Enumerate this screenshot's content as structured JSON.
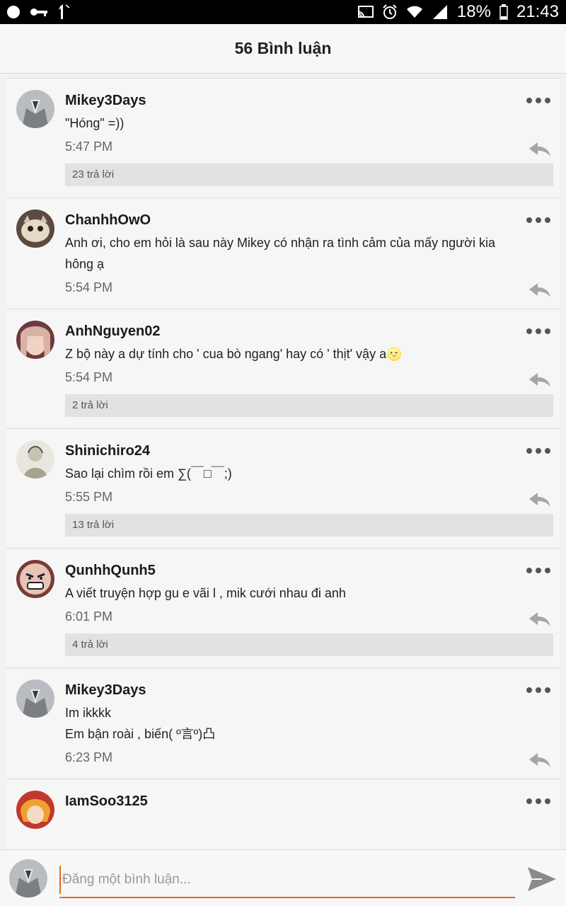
{
  "status_bar": {
    "battery": "18%",
    "time": "21:43",
    "icons": [
      "circle-icon",
      "key-icon",
      "data-arrow-icon",
      "cast-icon",
      "alarm-icon",
      "wifi-icon",
      "signal-icon",
      "battery-icon"
    ]
  },
  "header": {
    "title": "56 Bình luận"
  },
  "comments": [
    {
      "username": "Mikey3Days",
      "lines": [
        "\"Hóng\" =))"
      ],
      "time": "5:47 PM",
      "replies": "23 trả lời",
      "avatar": "avatar-grey-vest"
    },
    {
      "username": "ChanhhOwO",
      "lines": [
        "Anh ơi, cho em hỏi là sau này Mikey có nhận ra tình cảm của mấy người kia",
        "hông ạ"
      ],
      "time": "5:54 PM",
      "replies": "",
      "avatar": "avatar-cat"
    },
    {
      "username": "AnhNguyen02",
      "lines": [
        "Z bộ này a dự tính cho ' cua bò ngang' hay có ' thịt' vậy a🌝"
      ],
      "time": "5:54 PM",
      "replies": "2 trả lời",
      "avatar": "avatar-anime-pink"
    },
    {
      "username": "Shinichiro24",
      "lines": [
        "Sao lại chìm rồi em ∑(￣□￣;)"
      ],
      "time": "5:55 PM",
      "replies": "13 trả lời",
      "avatar": "avatar-sketch"
    },
    {
      "username": "QunhhQunh5",
      "lines": [
        "A viết truyện hợp gu e vãi l , mik cưới nhau đi anh"
      ],
      "time": "6:01 PM",
      "replies": "4 trả lời",
      "avatar": "avatar-rage-face"
    },
    {
      "username": "Mikey3Days",
      "lines": [
        "Im ikkkk",
        "Em bận roài , biến( º言º)凸"
      ],
      "time": "6:23 PM",
      "replies": "",
      "avatar": "avatar-grey-vest"
    },
    {
      "username": "IamSoo3125",
      "lines": [],
      "time": "",
      "replies": "",
      "avatar": "avatar-orange-hair"
    }
  ],
  "composer": {
    "placeholder": "Đăng một bình luận..."
  },
  "colors": {
    "accent": "#e86a1a",
    "background": "#f2f2f2",
    "reply_bar": "#e2e2e2"
  }
}
